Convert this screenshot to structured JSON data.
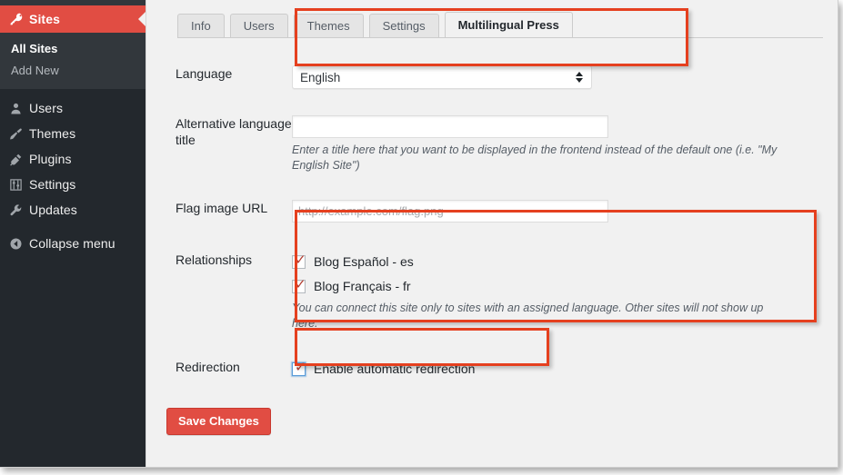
{
  "sidebar": {
    "current_item": {
      "label": "Sites",
      "icon": "key-icon"
    },
    "submenu": [
      {
        "label": "All Sites",
        "current": true
      },
      {
        "label": "Add New",
        "current": false
      }
    ],
    "items": [
      {
        "label": "Users",
        "icon": "user-icon"
      },
      {
        "label": "Themes",
        "icon": "paintbrush-icon"
      },
      {
        "label": "Plugins",
        "icon": "plug-icon"
      },
      {
        "label": "Settings",
        "icon": "sliders-icon"
      },
      {
        "label": "Updates",
        "icon": "wrench-icon"
      }
    ],
    "collapse": {
      "label": "Collapse menu",
      "icon": "arrow-left-circle-icon"
    }
  },
  "tabs": [
    {
      "label": "Info",
      "active": false
    },
    {
      "label": "Users",
      "active": false
    },
    {
      "label": "Themes",
      "active": false
    },
    {
      "label": "Settings",
      "active": false
    },
    {
      "label": "Multilingual Press",
      "active": true
    }
  ],
  "form": {
    "language": {
      "label": "Language",
      "selected": "English"
    },
    "alt_title": {
      "label": "Alternative language title",
      "value": "",
      "placeholder": "",
      "description": "Enter a title here that you want to be displayed in the frontend instead of the default one (i.e. \"My English Site\")"
    },
    "flag_url": {
      "label": "Flag image URL",
      "value": "",
      "placeholder": "http://example.com/flag.png"
    },
    "relationships": {
      "label": "Relationships",
      "options": [
        {
          "label": "Blog Español - es",
          "checked": true
        },
        {
          "label": "Blog Français - fr",
          "checked": true
        }
      ],
      "description": "You can connect this site only to sites with an assigned language. Other sites will not show up here."
    },
    "redirection": {
      "label": "Redirection",
      "option": {
        "label": "Enable automatic redirection",
        "checked": true,
        "focused": true
      }
    },
    "submit_label": "Save Changes"
  },
  "colors": {
    "accent_red": "#e14d43",
    "callout_red": "#e5401f",
    "sidebar_bg": "#23282d",
    "submenu_bg": "#32373c",
    "content_bg": "#f1f1f1",
    "focus_blue": "#5b9dd9"
  },
  "glyphs": {
    "check": "✓"
  }
}
